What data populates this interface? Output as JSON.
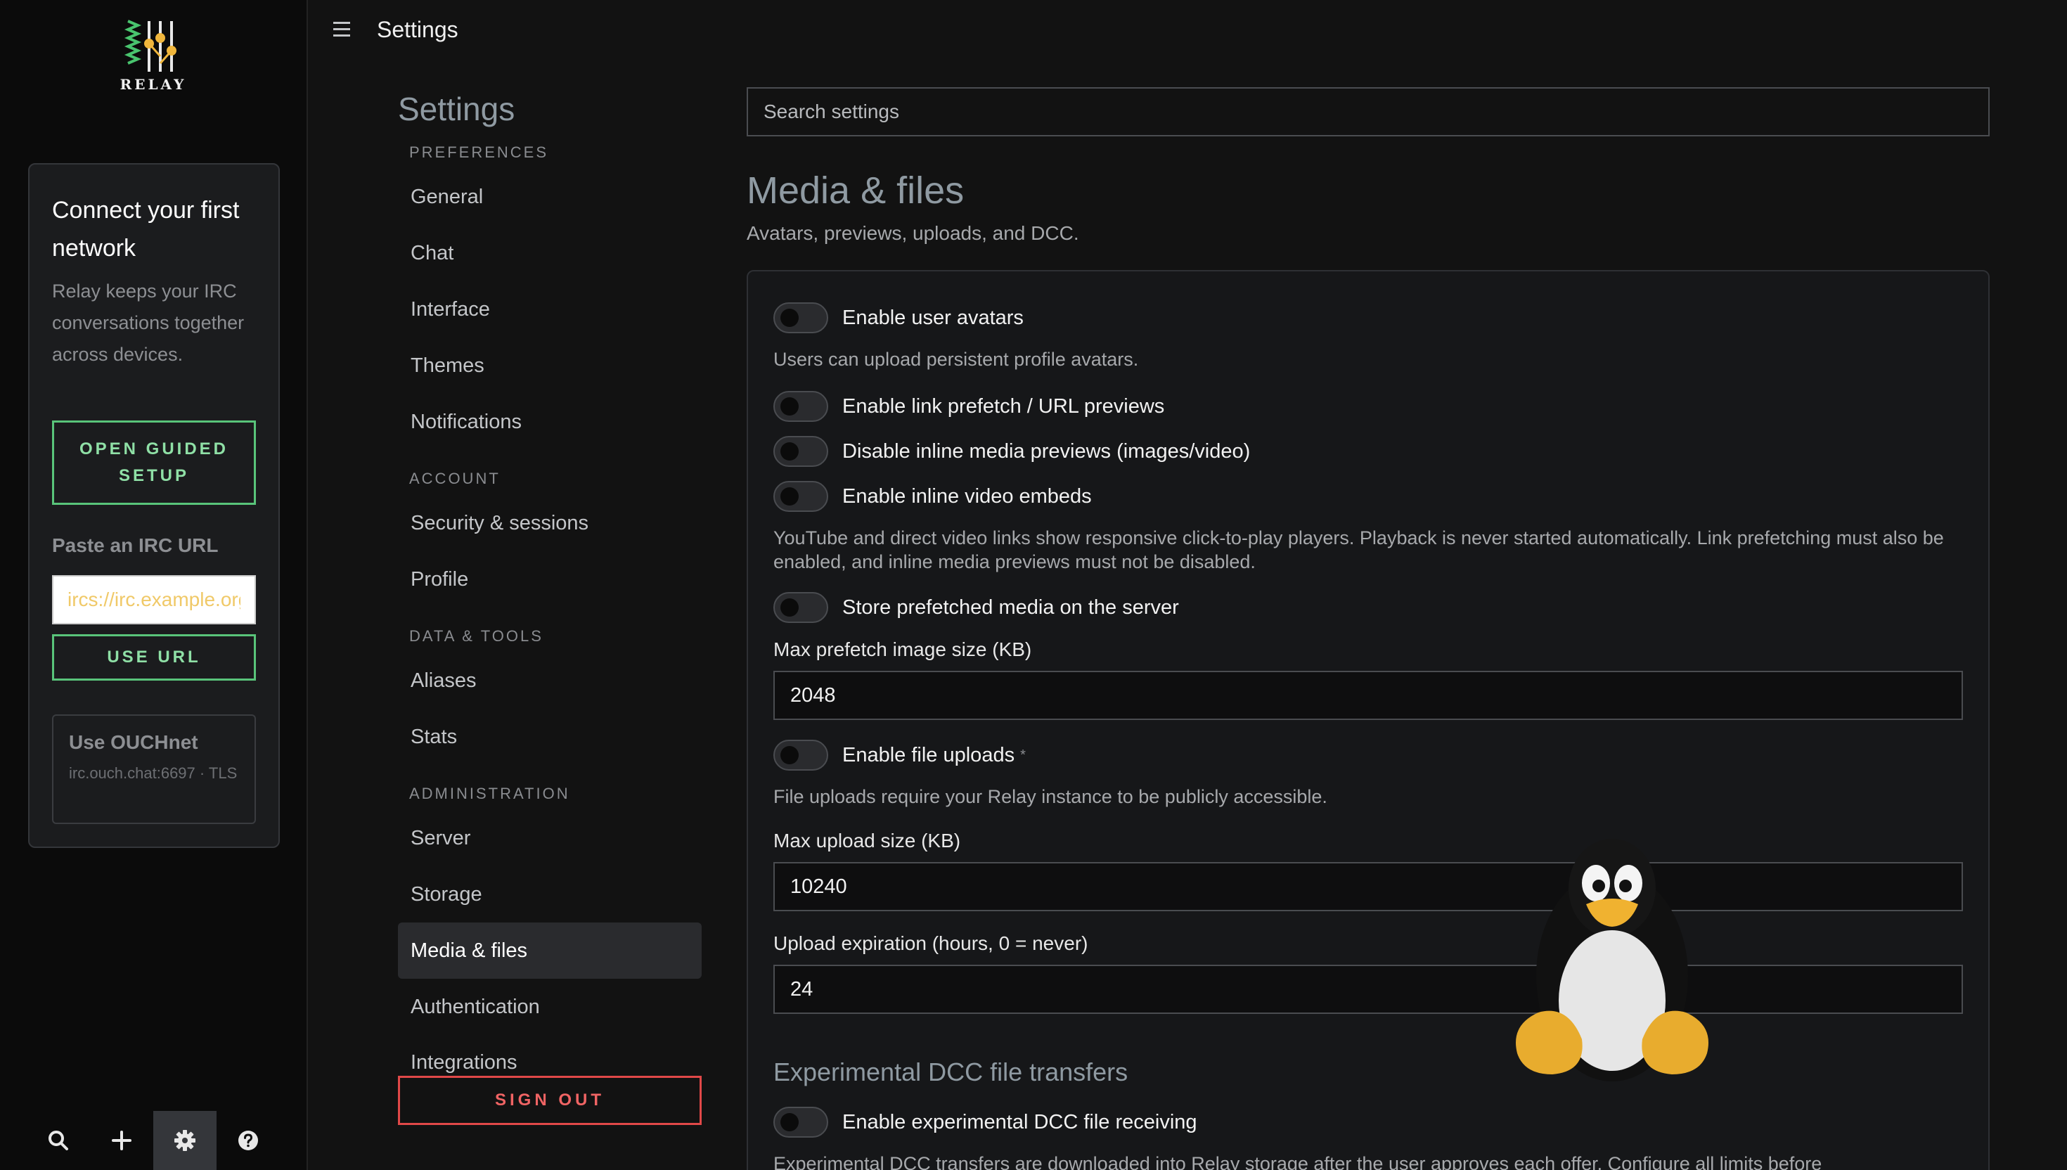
{
  "app": {
    "brand": "RELAY",
    "topbar_title": "Settings"
  },
  "connect": {
    "title": "Connect your first network",
    "description": "Relay keeps your IRC conversations together across devices.",
    "guided_button": "OPEN GUIDED SETUP",
    "paste_label": "Paste an IRC URL",
    "url_placeholder": "ircs://irc.example.org",
    "use_url_button": "USE URL",
    "ouch_title": "Use OUCHnet",
    "ouch_sub": "irc.ouch.chat:6697 · TLS"
  },
  "rail_icons": [
    "search-icon",
    "plus-icon",
    "gear-icon",
    "help-icon"
  ],
  "nav": {
    "heading": "Settings",
    "sections": {
      "preferences": "PREFERENCES",
      "account": "ACCOUNT",
      "data_tools": "DATA & TOOLS",
      "administration": "ADMINISTRATION"
    },
    "items": {
      "general": "General",
      "chat": "Chat",
      "interface": "Interface",
      "themes": "Themes",
      "notifications": "Notifications",
      "security": "Security & sessions",
      "profile": "Profile",
      "aliases": "Aliases",
      "stats": "Stats",
      "server": "Server",
      "storage": "Storage",
      "media": "Media & files",
      "authentication": "Authentication",
      "integrations": "Integrations"
    },
    "active": "Media & files",
    "sign_out": "SIGN OUT"
  },
  "main": {
    "search_placeholder": "Search settings",
    "title": "Media & files",
    "subtitle": "Avatars, previews, uploads, and DCC.",
    "toggles": {
      "avatars": "Enable user avatars",
      "prefetch": "Enable link prefetch / URL previews",
      "disable_inline": "Disable inline media previews (images/video)",
      "video_embeds": "Enable inline video embeds",
      "store_prefetched": "Store prefetched media on the server",
      "file_uploads": "Enable file uploads",
      "dcc": "Enable experimental DCC file receiving"
    },
    "required_mark": "*",
    "help": {
      "avatars": "Users can upload persistent profile avatars.",
      "video": "YouTube and direct video links show responsive click-to-play players. Playback is never started automatically. Link prefetching must also be enabled, and inline media previews must not be disabled.",
      "uploads": "File uploads require your Relay instance to be publicly accessible.",
      "dcc": "Experimental DCC transfers are downloaded into Relay storage after the user approves each offer. Configure all limits before"
    },
    "fields": {
      "max_prefetch_label": "Max prefetch image size (KB)",
      "max_prefetch_value": "2048",
      "max_upload_label": "Max upload size (KB)",
      "max_upload_value": "10240",
      "expiration_label": "Upload expiration (hours, 0 = never)",
      "expiration_value": "24"
    },
    "dcc_section_title": "Experimental DCC file transfers"
  },
  "colors": {
    "accent_green": "#59c47a",
    "danger_red": "#e04848",
    "background": "#121212"
  }
}
